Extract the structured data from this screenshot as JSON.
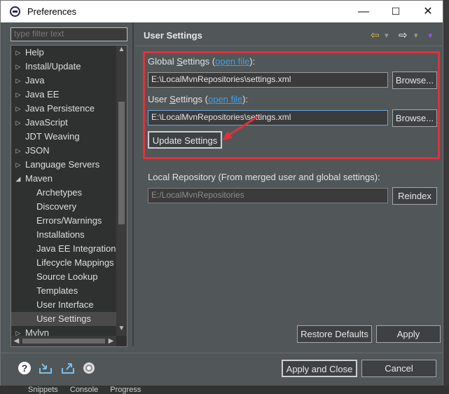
{
  "window": {
    "title": "Preferences",
    "minimize": "—",
    "maximize": "☐",
    "close": "✕"
  },
  "filter": {
    "placeholder": "type filter text"
  },
  "tree": {
    "items": [
      {
        "label": "Help",
        "level": 0,
        "expander": "▷"
      },
      {
        "label": "Install/Update",
        "level": 0,
        "expander": "▷"
      },
      {
        "label": "Java",
        "level": 0,
        "expander": "▷"
      },
      {
        "label": "Java EE",
        "level": 0,
        "expander": "▷"
      },
      {
        "label": "Java Persistence",
        "level": 0,
        "expander": "▷"
      },
      {
        "label": "JavaScript",
        "level": 0,
        "expander": "▷"
      },
      {
        "label": "JDT Weaving",
        "level": 0,
        "expander": ""
      },
      {
        "label": "JSON",
        "level": 0,
        "expander": "▷"
      },
      {
        "label": "Language Servers",
        "level": 0,
        "expander": "▷"
      },
      {
        "label": "Maven",
        "level": 0,
        "expander": "◢"
      },
      {
        "label": "Archetypes",
        "level": 1,
        "expander": ""
      },
      {
        "label": "Discovery",
        "level": 1,
        "expander": ""
      },
      {
        "label": "Errors/Warnings",
        "level": 1,
        "expander": ""
      },
      {
        "label": "Installations",
        "level": 1,
        "expander": ""
      },
      {
        "label": "Java EE Integration",
        "level": 1,
        "expander": ""
      },
      {
        "label": "Lifecycle Mappings",
        "level": 1,
        "expander": ""
      },
      {
        "label": "Source Lookup",
        "level": 1,
        "expander": ""
      },
      {
        "label": "Templates",
        "level": 1,
        "expander": ""
      },
      {
        "label": "User Interface",
        "level": 1,
        "expander": ""
      },
      {
        "label": "User Settings",
        "level": 1,
        "expander": "",
        "selected": true
      },
      {
        "label": "Mylyn",
        "level": 0,
        "expander": "▷"
      }
    ],
    "scroll_up": "▲",
    "scroll_down": "▼",
    "scroll_left": "◀",
    "scroll_right": "▶"
  },
  "page": {
    "title": "User Settings",
    "nav": {
      "back": "⇦",
      "forward": "⇨",
      "menu": "▾",
      "dropdown": "▾"
    },
    "global": {
      "label_prefix": "Global ",
      "label_underlined": "S",
      "label_rest": "ettings (",
      "link": "open file",
      "label_suffix": "):",
      "value": "E:\\LocalMvnRepositories\\settings.xml",
      "browse": "Browse..."
    },
    "user": {
      "label_prefix": "User ",
      "label_underlined": "S",
      "label_rest": "ettings (",
      "link": "open file",
      "label_suffix": "):",
      "value": "E:\\LocalMvnRepositories\\settings.xml",
      "browse": "Browse..."
    },
    "update_button": "Update Settings",
    "local_repo": {
      "label": "Local Repository (From merged user and global settings):",
      "value": "E:/LocalMvnRepositories",
      "reindex": "Reindex"
    },
    "restore_defaults": "Restore Defaults",
    "apply": "Apply"
  },
  "footer": {
    "apply_close": "Apply and Close",
    "cancel": "Cancel",
    "icons": [
      "help-icon",
      "import-icon",
      "export-icon",
      "record-icon"
    ]
  },
  "background_tabs": [
    "Snippets",
    "Console",
    "Progress"
  ],
  "colors": {
    "annotation": "#e0313a",
    "link": "#3aa0e6",
    "accent_arrow": "#e8b84a"
  }
}
